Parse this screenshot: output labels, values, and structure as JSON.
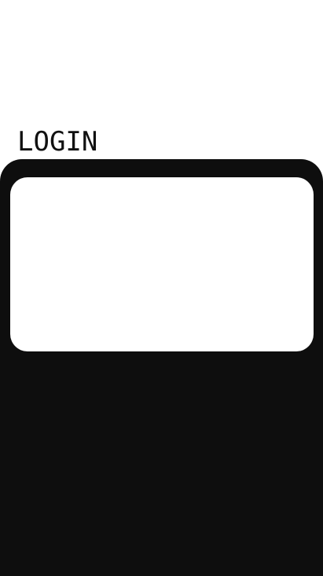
{
  "screen": {
    "title": "LOGIN"
  },
  "colors": {
    "background": "#ffffff",
    "panel": "#0e0e0e",
    "card": "#ffffff",
    "title_text": "#111111"
  }
}
